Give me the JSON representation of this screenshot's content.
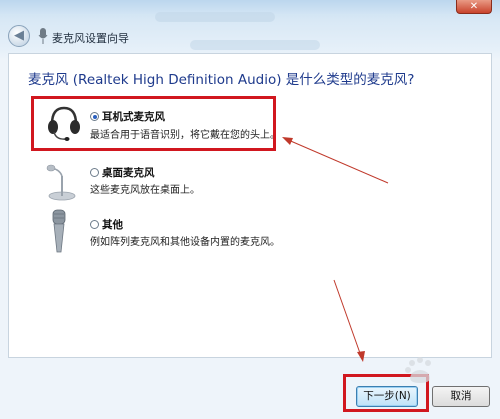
{
  "window": {
    "title": "麦克风设置向导",
    "close_glyph": "✕",
    "back_glyph": "◀"
  },
  "question": "麦克风 (Realtek High Definition Audio) 是什么类型的麦克风?",
  "options": [
    {
      "label": "耳机式麦克风",
      "desc": "最适合用于语音识别，将它戴在您的头上。",
      "selected": true,
      "icon": "headset-icon"
    },
    {
      "label": "桌面麦克风",
      "desc": "这些麦克风放在桌面上。",
      "selected": false,
      "icon": "desktop-mic-icon"
    },
    {
      "label": "其他",
      "desc": "例如阵列麦克风和其他设备内置的麦克风。",
      "selected": false,
      "icon": "handheld-mic-icon"
    }
  ],
  "buttons": {
    "next": "下一步(N)",
    "cancel": "取消"
  },
  "colors": {
    "annotation": "#d1171f",
    "question_text": "#1e3a8c"
  }
}
